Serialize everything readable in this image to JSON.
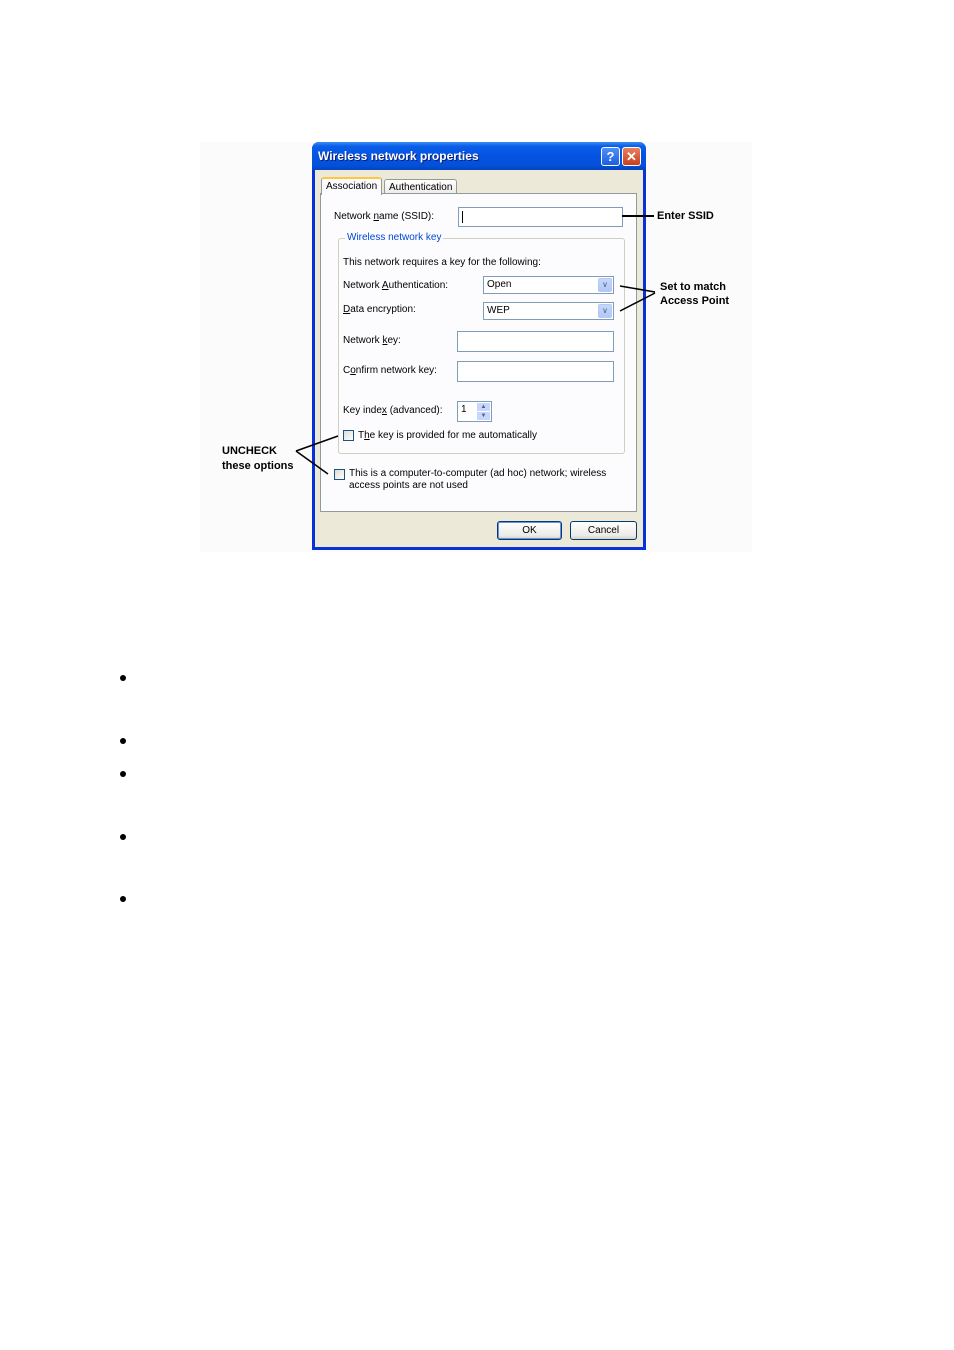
{
  "dialog": {
    "title": "Wireless network properties",
    "help_button": "?",
    "close_button": "✕",
    "tabs": [
      {
        "label": "Association",
        "active": true
      },
      {
        "label": "Authentication",
        "active": false
      }
    ],
    "ssid_label": "Network name (SSID):",
    "ssid_value": "",
    "group_label": "Wireless network key",
    "requires_text": "This network requires a key for the following:",
    "auth_label": "Network Authentication:",
    "auth_value": "Open",
    "encryption_label": "Data encryption:",
    "encryption_value": "WEP",
    "key_label": "Network key:",
    "key_value": "",
    "confirm_label": "Confirm network key:",
    "confirm_value": "",
    "key_index_label": "Key index (advanced):",
    "key_index_value": "1",
    "auto_key_label": "The key is provided for me automatically",
    "auto_key_checked": false,
    "adhoc_label_line1": "This is a computer-to-computer (ad hoc) network; wireless",
    "adhoc_label_line2": "access points are not used",
    "adhoc_checked": false,
    "ok_label": "OK",
    "cancel_label": "Cancel"
  },
  "annotations": {
    "enter_ssid": "Enter SSID",
    "set_match_line1": "Set to match",
    "set_match_line2": "Access Point",
    "uncheck_line1": "UNCHECK",
    "uncheck_line2": "these options"
  },
  "bullets": [
    "",
    "",
    "",
    "",
    ""
  ]
}
